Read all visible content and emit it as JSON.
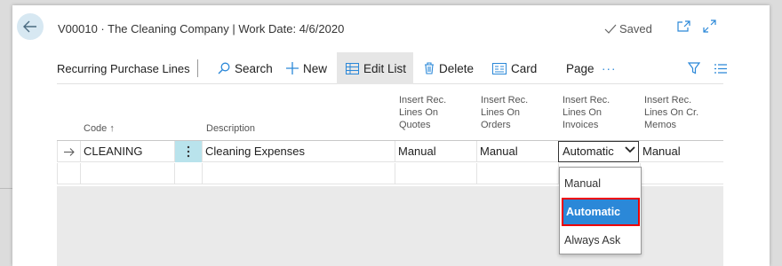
{
  "header": {
    "title": "V00010 · The Cleaning Company | Work Date: 4/6/2020",
    "saved_label": "Saved"
  },
  "actionbar": {
    "page_name": "Recurring Purchase Lines",
    "search_label": "Search",
    "new_label": "New",
    "edit_list_label": "Edit List",
    "delete_label": "Delete",
    "card_label": "Card",
    "page_label": "Page",
    "more_label": "···"
  },
  "columns": {
    "code": "Code ↑",
    "description": "Description",
    "quotes": [
      "Insert Rec.",
      "Lines On",
      "Quotes"
    ],
    "orders": [
      "Insert Rec.",
      "Lines On",
      "Orders"
    ],
    "invoices": [
      "Insert Rec.",
      "Lines On",
      "Invoices"
    ],
    "cr_memos": [
      "Insert Rec.",
      "Lines On Cr.",
      "Memos"
    ]
  },
  "rows": [
    {
      "code": "CLEANING",
      "description": "Cleaning Expenses",
      "quotes": "Manual",
      "orders": "Manual",
      "invoices": "Automatic",
      "cr_memos": "Manual"
    }
  ],
  "dropdown": {
    "options": [
      "Manual",
      "Automatic",
      "Always Ask"
    ],
    "selected": "Automatic"
  },
  "icons": {
    "back": "back-arrow-icon",
    "saved": "checkmark-icon",
    "open_new": "open-in-new-window-icon",
    "expand": "expand-icon",
    "search": "search-icon",
    "new": "plus-icon",
    "edit_list": "edit-list-icon",
    "delete": "trash-icon",
    "card": "card-icon",
    "filter": "filter-icon",
    "list": "list-view-icon",
    "row_arrow": "row-arrow-icon",
    "row_menu": "vertical-ellipsis-icon"
  },
  "colors": {
    "accent": "#2b88d8",
    "highlight_border": "#e00000",
    "row_menu_bg": "#b9e3ec",
    "back_button_bg": "#d7e8f2"
  }
}
